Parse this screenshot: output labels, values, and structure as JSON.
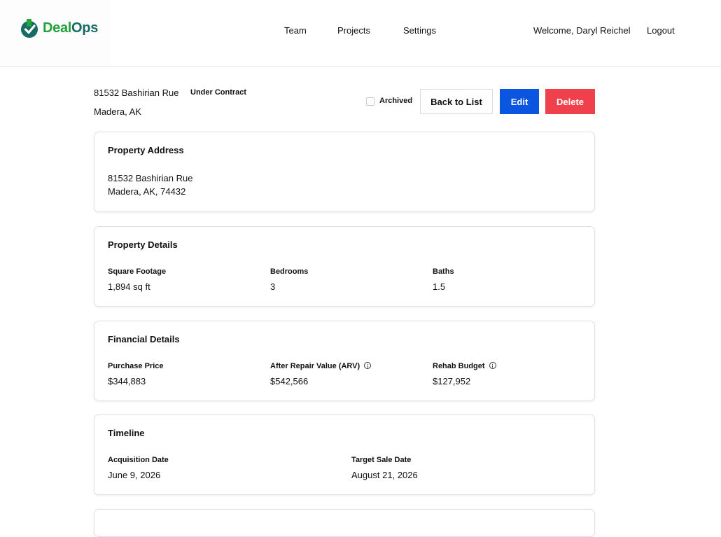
{
  "brand": {
    "name_part1": "Deal",
    "name_part2": "Ops"
  },
  "nav": {
    "team": "Team",
    "projects": "Projects",
    "settings": "Settings"
  },
  "user": {
    "welcome": "Welcome, Daryl Reichel",
    "logout": "Logout"
  },
  "property": {
    "street": "81532 Bashirian Rue",
    "city_state": "Madera, AK",
    "status": "Under Contract"
  },
  "actions": {
    "archived_label": "Archived",
    "archived_checked": false,
    "back": "Back to List",
    "edit": "Edit",
    "delete": "Delete"
  },
  "address_card": {
    "title": "Property Address",
    "line1": "81532 Bashirian Rue",
    "line2": "Madera, AK, 74432"
  },
  "details_card": {
    "title": "Property Details",
    "fields": [
      {
        "label": "Square Footage",
        "value": "1,894 sq ft"
      },
      {
        "label": "Bedrooms",
        "value": "3"
      },
      {
        "label": "Baths",
        "value": "1.5"
      }
    ]
  },
  "financial_card": {
    "title": "Financial Details",
    "fields": [
      {
        "label": "Purchase Price",
        "value": "$344,883"
      },
      {
        "label": "After Repair Value (ARV)",
        "value": "$542,566"
      },
      {
        "label": "Rehab Budget",
        "value": "$127,952"
      }
    ]
  },
  "timeline_card": {
    "title": "Timeline",
    "fields": [
      {
        "label": "Acquisition Date",
        "value": "June 9, 2026"
      },
      {
        "label": "Target Sale Date",
        "value": "August 21, 2026"
      }
    ]
  },
  "colors": {
    "brand_green": "#22a33b",
    "brand_teal": "#176b66",
    "primary": "#0a56e0",
    "danger": "#f0404c"
  }
}
